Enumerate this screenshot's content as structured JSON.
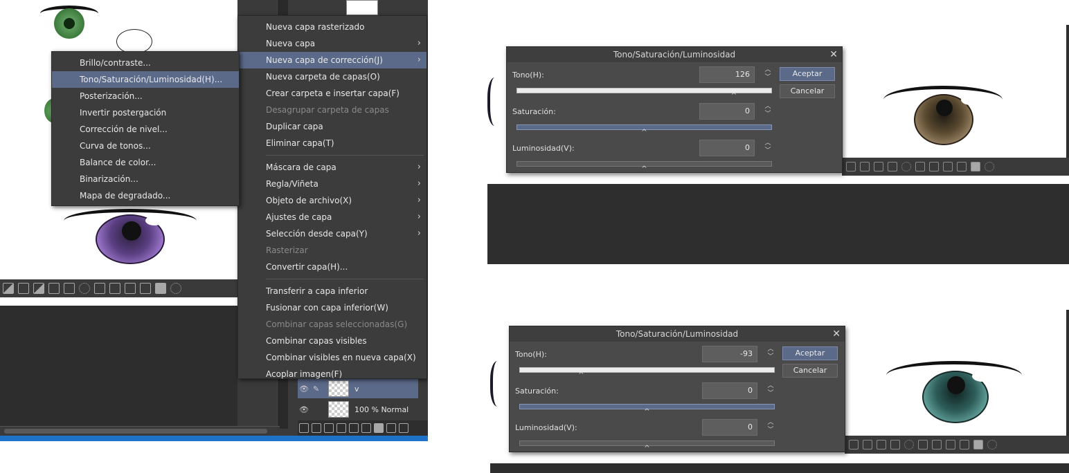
{
  "main_menu": {
    "items": [
      {
        "label": "Nueva capa rasterizado"
      },
      {
        "label": "Nueva capa",
        "submenu": true
      },
      {
        "label": "Nueva capa de corrección(J)",
        "submenu": true,
        "highlighted": true
      },
      {
        "label": "Nueva carpeta de capas(O)"
      },
      {
        "label": "Crear carpeta e insertar capa(F)"
      },
      {
        "label": "Desagrupar carpeta de capas",
        "disabled": true
      },
      {
        "label": "Duplicar capa"
      },
      {
        "label": "Eliminar capa(T)"
      },
      {
        "separator": true
      },
      {
        "label": "Máscara de capa",
        "submenu": true
      },
      {
        "label": "Regla/Viñeta",
        "submenu": true
      },
      {
        "label": "Objeto de archivo(X)",
        "submenu": true
      },
      {
        "label": "Ajustes de capa",
        "submenu": true
      },
      {
        "label": "Selección desde capa(Y)",
        "submenu": true
      },
      {
        "label": "Rasterizar",
        "disabled": true
      },
      {
        "label": "Convertir capa(H)..."
      },
      {
        "separator": true
      },
      {
        "label": "Transferir a capa inferior"
      },
      {
        "label": "Fusionar con capa inferior(W)"
      },
      {
        "label": "Combinar capas seleccionadas(G)",
        "disabled": true
      },
      {
        "label": "Combinar capas visibles"
      },
      {
        "label": "Combinar visibles en nueva capa(X)"
      },
      {
        "label": "Acoplar imagen(F)"
      }
    ]
  },
  "sub_menu": {
    "items": [
      {
        "label": "Brillo/contraste..."
      },
      {
        "label": "Tono/Saturación/Luminosidad(H)...",
        "highlighted": true
      },
      {
        "label": "Posterización..."
      },
      {
        "label": "Invertir postergación"
      },
      {
        "label": "Corrección de nivel..."
      },
      {
        "label": "Curva de tonos..."
      },
      {
        "label": "Balance de color..."
      },
      {
        "label": "Binarización..."
      },
      {
        "label": "Mapa de degradado..."
      }
    ]
  },
  "layer_panel": {
    "selected_layer_name": "v",
    "layer_2_blend": "100 % Normal"
  },
  "dialogs": [
    {
      "title": "Tono/Saturación/Luminosidad",
      "hue_label": "Tono(H):",
      "hue_value": "126",
      "sat_label": "Saturación:",
      "sat_value": "0",
      "lum_label": "Luminosidad(V):",
      "lum_value": "0",
      "ok_label": "Aceptar",
      "cancel_label": "Cancelar",
      "hue_slider": 0.851,
      "sat_slider": 0.5,
      "lum_slider": 0.5
    },
    {
      "title": "Tono/Saturación/Luminosidad",
      "hue_label": "Tono(H):",
      "hue_value": "-93",
      "sat_label": "Saturación:",
      "sat_value": "0",
      "lum_label": "Luminosidad(V):",
      "lum_value": "0",
      "ok_label": "Aceptar",
      "cancel_label": "Cancelar",
      "hue_slider": 0.242,
      "sat_slider": 0.5,
      "lum_slider": 0.5
    }
  ],
  "colors": {
    "menu_bg": "#3c3c3c",
    "highlight": "#5c6a8a",
    "disabled_text": "#8a8a8a",
    "eye_green": "#4a8a4a",
    "eye_purple": "#7a5aa8",
    "eye_brown": "#8a6a4a",
    "eye_teal": "#4a8a8a"
  },
  "icons": [
    "close-icon",
    "chevron-right-icon",
    "spin-up-down-icon",
    "slider-marker-icon",
    "visibility-eye-icon",
    "pen-icon"
  ]
}
